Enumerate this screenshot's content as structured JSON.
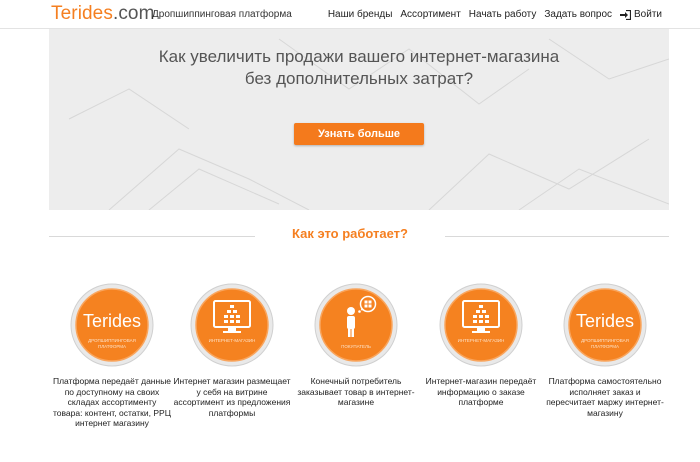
{
  "header": {
    "logo_main": "Terides",
    "logo_dot": ".com",
    "tagline": "Дропшиппинговая платформа",
    "nav": [
      "Наши бренды",
      "Ассортимент",
      "Начать работу",
      "Задать вопрос"
    ],
    "login": "Войти"
  },
  "hero": {
    "title_line1": "Как увеличить продажи вашего интернет-магазина",
    "title_line2": "без дополнительных затрат?",
    "cta": "Узнать больше"
  },
  "section": {
    "title": "Как это работает?"
  },
  "steps": [
    {
      "icon": "terides-logo-icon",
      "circle_title": "Terides",
      "circle_caption": "ДРОПШИППИНГОВАЯ ПЛАТФОРМА",
      "text": "Платформа передаёт данные по доступному на своих складах ассортименту товара: контент, остатки, РРЦ интернет магазину"
    },
    {
      "icon": "monitor-icon",
      "circle_title": "",
      "circle_caption": "ИНТЕРНЕТ-МАГАЗИН",
      "text": "Интернет магазин размещает у себя на витрине ассортимент из предложения платформы"
    },
    {
      "icon": "buyer-icon",
      "circle_title": "",
      "circle_caption": "ПОКУПАТЕЛЬ",
      "text": "Конечный потребитель заказывает товар в интернет-магазине"
    },
    {
      "icon": "monitor-icon",
      "circle_title": "",
      "circle_caption": "ИНТЕРНЕТ-МАГАЗИН",
      "text": "Интернет-магазин передаёт информацию о заказе платформе"
    },
    {
      "icon": "terides-logo-icon",
      "circle_title": "Terides",
      "circle_caption": "ДРОПШИППИНГОВАЯ ПЛАТФОРМА",
      "text": "Платформа самостоятельно исполняет заказ и пересчитает маржу интернет-магазину"
    }
  ],
  "colors": {
    "accent": "#f57f20",
    "hero_bg": "#ededed"
  }
}
